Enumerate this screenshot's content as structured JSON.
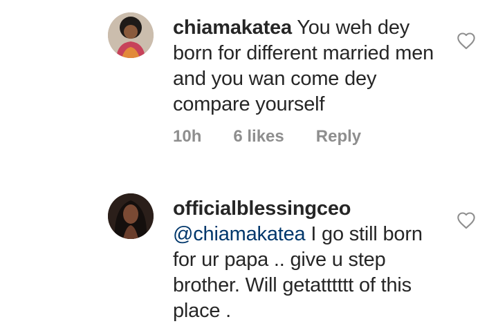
{
  "comments": [
    {
      "username": "chiamakatea",
      "text": "You weh dey born for different married men and you wan come dey compare yourself",
      "time": "10h",
      "likes": "6 likes",
      "reply_label": "Reply"
    },
    {
      "username": "officialblessingceo",
      "mention": "@chiamakatea",
      "text": "I go still born for ur papa .. give u step brother. Will getatttttt of this place ."
    }
  ],
  "colors": {
    "text": "#262626",
    "muted": "#8e8e8e",
    "mention": "#00376b"
  },
  "icons": {
    "like": "heart-outline-icon"
  }
}
